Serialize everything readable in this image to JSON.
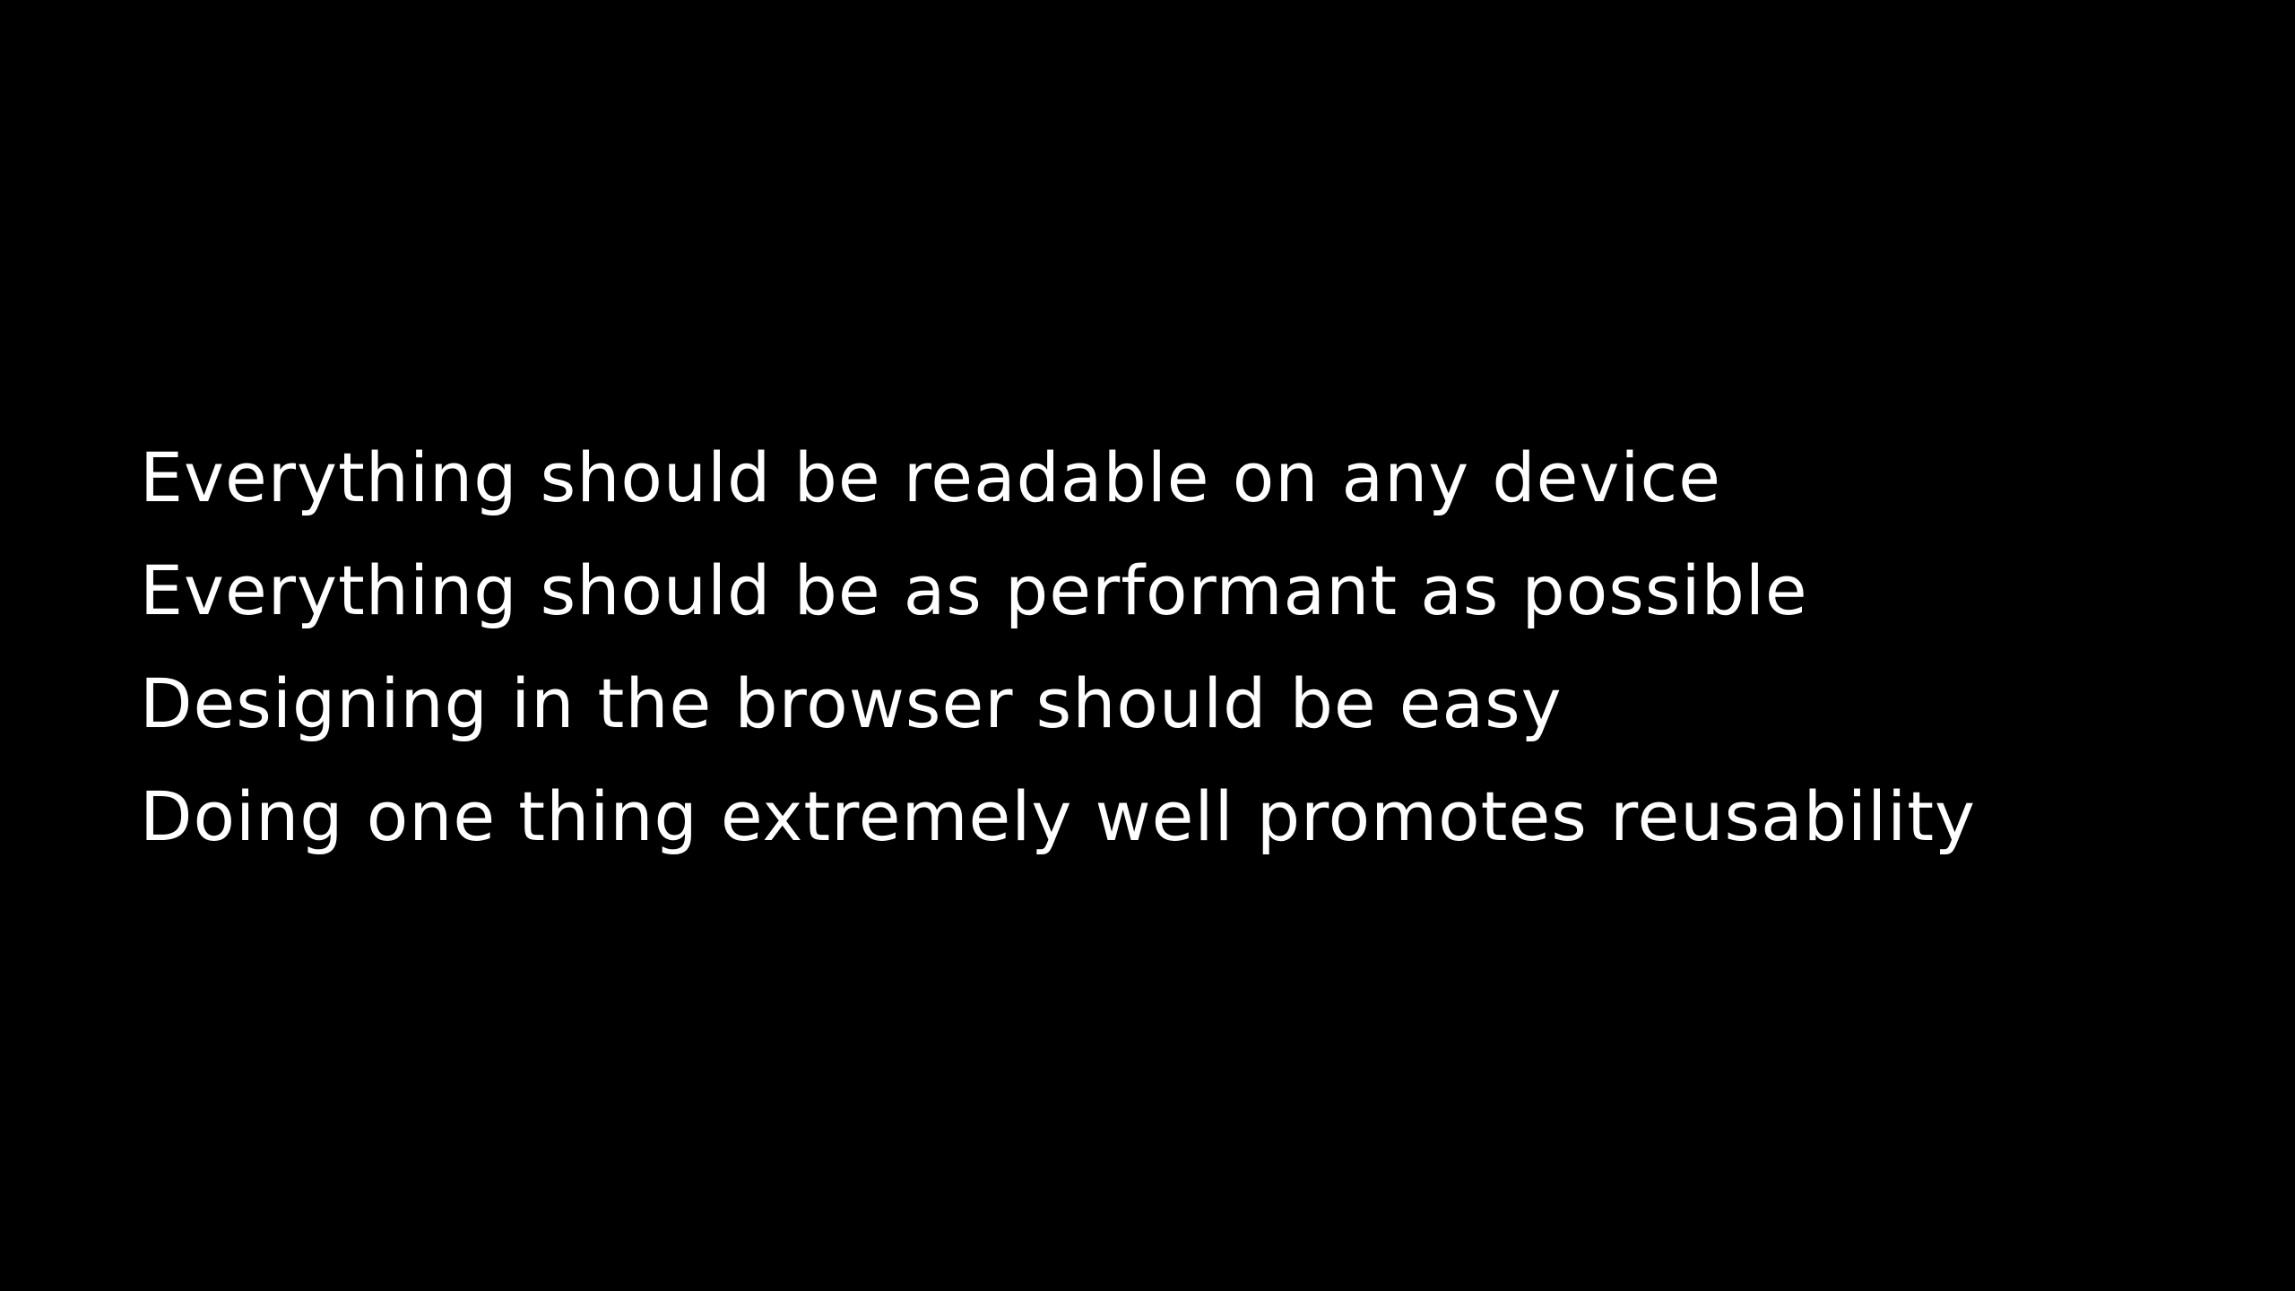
{
  "slide": {
    "background_color": "#000000",
    "text_color": "#ffffff",
    "lines": [
      "Everything should be readable on any device",
      "Everything should be as performant as possible",
      "Designing in the browser should be easy",
      "Doing one thing extremely well promotes reusability"
    ]
  }
}
